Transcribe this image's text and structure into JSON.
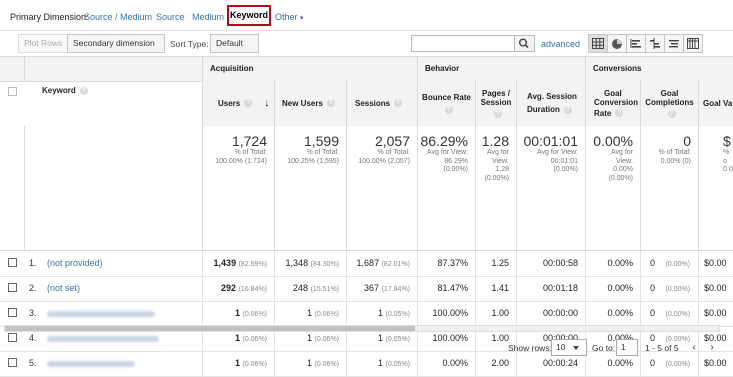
{
  "dimension_bar": {
    "label": "Primary Dimension:",
    "links": [
      "Source / Medium",
      "Source",
      "Medium"
    ],
    "selected": "Keyword",
    "other": "Other"
  },
  "toolbar": {
    "plot_rows": "Plot Rows",
    "secondary_dimension": "Secondary dimension",
    "sort_type_label": "Sort Type:",
    "sort_type_value": "Default",
    "search_value": "",
    "advanced": "advanced",
    "view_icons": [
      "table-view-icon",
      "pie-view-icon",
      "performance-view-icon",
      "comparison-view-icon",
      "term-cloud-icon",
      "pivot-view-icon"
    ]
  },
  "table": {
    "groups": {
      "acquisition": "Acquisition",
      "behavior": "Behavior",
      "conversions": "Conversions"
    },
    "headers": {
      "keyword": "Keyword",
      "users": "Users",
      "new_users": "New Users",
      "sessions": "Sessions",
      "bounce_rate": "Bounce Rate",
      "pages_session_1": "Pages /",
      "pages_session_2": "Session",
      "avg_duration_1": "Avg. Session",
      "avg_duration_2": "Duration",
      "goal_conv_1": "Goal",
      "goal_conv_2": "Conversion",
      "goal_conv_3": "Rate",
      "goal_comp_1": "Goal",
      "goal_comp_2": "Completions",
      "goal_value": "Goal Va"
    },
    "totals": {
      "users": {
        "big": "1,724",
        "l1": "% of Total:",
        "l2": "100.00% (1,724)"
      },
      "new_users": {
        "big": "1,599",
        "l1": "% of Total:",
        "l2": "100.25% (1,595)"
      },
      "sessions": {
        "big": "2,057",
        "l1": "% of Total:",
        "l2": "100.00% (2,057)"
      },
      "bounce_rate": {
        "big": "86.29%",
        "l1": "Avg for View:",
        "l2": "86.29%",
        "l3": "(0.00%)"
      },
      "pages_session": {
        "big": "1.28",
        "l1": "Avg for",
        "l2": "View:",
        "l3": "1.28",
        "l4": "(0.00%)"
      },
      "avg_duration": {
        "big": "00:01:01",
        "l1": "Avg for View:",
        "l2": "00:01:01",
        "l3": "(0.00%)"
      },
      "goal_conv": {
        "big": "0.00%",
        "l1": "Avg for",
        "l2": "View:",
        "l3": "0.00%",
        "l4": "(0.00%)"
      },
      "goal_comp": {
        "big": "0",
        "l1": "% of Total:",
        "l2": "0.00% (0)"
      },
      "goal_value": {
        "big": "$",
        "l1": "% o",
        "l2": "0.00"
      }
    },
    "rows": [
      {
        "no": "1.",
        "keyword": "(not provided)",
        "blurred": false,
        "users": "1,439",
        "users_pct": "(82.99%)",
        "new_users": "1,348",
        "new_users_pct": "(84.30%)",
        "sessions": "1,687",
        "sessions_pct": "(82.01%)",
        "bounce": "87.37%",
        "pages": "1.25",
        "duration": "00:00:58",
        "conv": "0.00%",
        "comp": "0",
        "comp_pct": "(0.00%)",
        "value": "$0.00"
      },
      {
        "no": "2.",
        "keyword": "(not set)",
        "blurred": false,
        "users": "292",
        "users_pct": "(16.84%)",
        "new_users": "248",
        "new_users_pct": "(15.51%)",
        "sessions": "367",
        "sessions_pct": "(17.84%)",
        "bounce": "81.47%",
        "pages": "1.41",
        "duration": "00:01:18",
        "conv": "0.00%",
        "comp": "0",
        "comp_pct": "(0.00%)",
        "value": "$0.00"
      },
      {
        "no": "3.",
        "keyword": "",
        "blurred": true,
        "users": "1",
        "users_pct": "(0.06%)",
        "new_users": "1",
        "new_users_pct": "(0.06%)",
        "sessions": "1",
        "sessions_pct": "(0.05%)",
        "bounce": "100.00%",
        "pages": "1.00",
        "duration": "00:00:00",
        "conv": "0.00%",
        "comp": "0",
        "comp_pct": "(0.00%)",
        "value": "$0.00"
      },
      {
        "no": "4.",
        "keyword": "",
        "blurred": true,
        "users": "1",
        "users_pct": "(0.06%)",
        "new_users": "1",
        "new_users_pct": "(0.06%)",
        "sessions": "1",
        "sessions_pct": "(0.05%)",
        "bounce": "100.00%",
        "pages": "1.00",
        "duration": "00:00:00",
        "conv": "0.00%",
        "comp": "0",
        "comp_pct": "(0.00%)",
        "value": "$0.00"
      },
      {
        "no": "5.",
        "keyword": "",
        "blurred": true,
        "users": "1",
        "users_pct": "(0.06%)",
        "new_users": "1",
        "new_users_pct": "(0.06%)",
        "sessions": "1",
        "sessions_pct": "(0.05%)",
        "bounce": "0.00%",
        "pages": "2.00",
        "duration": "00:00:24",
        "conv": "0.00%",
        "comp": "0",
        "comp_pct": "(0.00%)",
        "value": "$0.00"
      }
    ]
  },
  "footer": {
    "show_rows_label": "Show rows:",
    "show_rows_value": "10",
    "goto_label": "Go to:",
    "goto_value": "1",
    "range": "1 - 5 of 5"
  }
}
